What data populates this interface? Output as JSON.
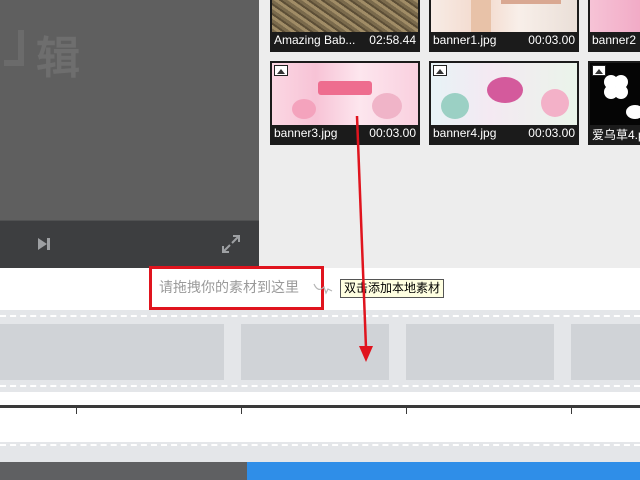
{
  "preview": {
    "watermark": "辑",
    "controls": {
      "next_icon": "next-frame-icon",
      "fullscreen_icon": "fullscreen-icon"
    }
  },
  "library": {
    "items": [
      {
        "name": "Amazing Bab...",
        "duration": "02:58.44",
        "icon": "video-thumbnail"
      },
      {
        "name": "banner1.jpg",
        "duration": "00:03.00",
        "icon": "image-thumbnail"
      },
      {
        "name": "banner2",
        "duration": "",
        "icon": "image-thumbnail"
      },
      {
        "name": "banner3.jpg",
        "duration": "00:03.00",
        "icon": "image-icon"
      },
      {
        "name": "banner4.jpg",
        "duration": "00:03.00",
        "icon": "image-icon"
      },
      {
        "name": "爱乌草4.p",
        "duration": "",
        "icon": "image-icon"
      }
    ]
  },
  "dropzone": {
    "hint": "请拖拽你的素材到这里",
    "tooltip": "双击添加本地素材"
  },
  "colors": {
    "annotation_red": "#e0141e",
    "accent_blue": "#2f8ee8",
    "tooltip_bg": "#ffffe1"
  }
}
